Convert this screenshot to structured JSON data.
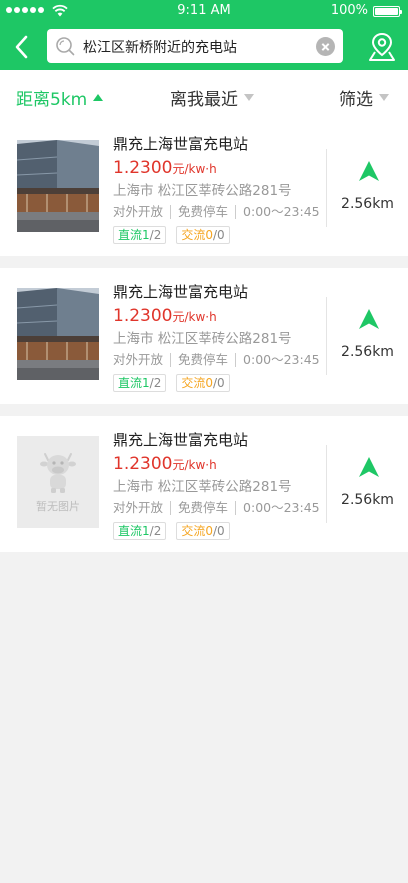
{
  "status_bar": {
    "time": "9:11 AM",
    "battery": "100%",
    "battery_level": 1.0
  },
  "nav": {
    "back_icon": "chevron-left-icon",
    "search_icon": "search-icon",
    "search_value": "松江区新桥附近的充电站",
    "clear_icon": "clear-circle-icon",
    "map_icon": "map-pin-icon"
  },
  "filters": [
    {
      "label": "距离5km",
      "active": true
    },
    {
      "label": "离我最近",
      "active": false
    },
    {
      "label": "筛选",
      "active": false
    }
  ],
  "colors": {
    "brand_green": "#1ec765",
    "price_red": "#e0352b",
    "ac_orange": "#f5a623"
  },
  "stations": [
    {
      "name": "鼎充上海世富充电站",
      "price": "1.2300",
      "price_unit": "元/kw·h",
      "address": "上海市  松江区莘砖公路281号",
      "open": "对外开放",
      "parking": "免费停车",
      "hours": "0:00～23:45",
      "dc_label": "直流",
      "dc_available": "1",
      "dc_total": "/2",
      "ac_label": "交流",
      "ac_available": "0",
      "ac_total": "/0",
      "distance": "2.56km",
      "has_photo": true
    },
    {
      "name": "鼎充上海世富充电站",
      "price": "1.2300",
      "price_unit": "元/kw·h",
      "address": "上海市  松江区莘砖公路281号",
      "open": "对外开放",
      "parking": "免费停车",
      "hours": "0:00～23:45",
      "dc_label": "直流",
      "dc_available": "1",
      "dc_total": "/2",
      "ac_label": "交流",
      "ac_available": "0",
      "ac_total": "/0",
      "distance": "2.56km",
      "has_photo": true
    },
    {
      "name": "鼎充上海世富充电站",
      "price": "1.2300",
      "price_unit": "元/kw·h",
      "address": "上海市  松江区莘砖公路281号",
      "open": "对外开放",
      "parking": "免费停车",
      "hours": "0:00～23:45",
      "dc_label": "直流",
      "dc_available": "1",
      "dc_total": "/2",
      "ac_label": "交流",
      "ac_available": "0",
      "ac_total": "/0",
      "distance": "2.56km",
      "has_photo": false,
      "placeholder_text": "暂无图片"
    }
  ]
}
